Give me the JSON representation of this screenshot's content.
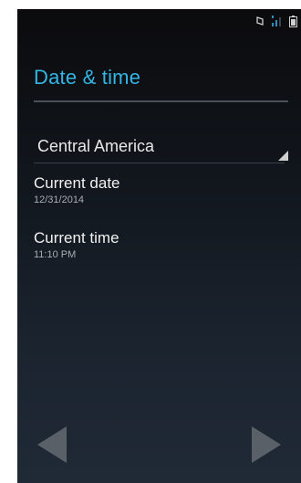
{
  "status_bar": {
    "icons": [
      "rotate-icon",
      "signal-icon",
      "battery-icon"
    ]
  },
  "header": {
    "title": "Date & time"
  },
  "timezone_spinner": {
    "selected": "Central America"
  },
  "preferences": [
    {
      "title": "Current date",
      "summary": "12/31/2014"
    },
    {
      "title": "Current time",
      "summary": "11:10 PM"
    }
  ],
  "navigation": {
    "prev_icon": "triangle-left-icon",
    "next_icon": "triangle-right-icon"
  },
  "colors": {
    "accent": "#33b5e5",
    "background_top": "#0b0b0d",
    "background_bottom": "#202a36",
    "nav_arrow": "#5a6068"
  }
}
